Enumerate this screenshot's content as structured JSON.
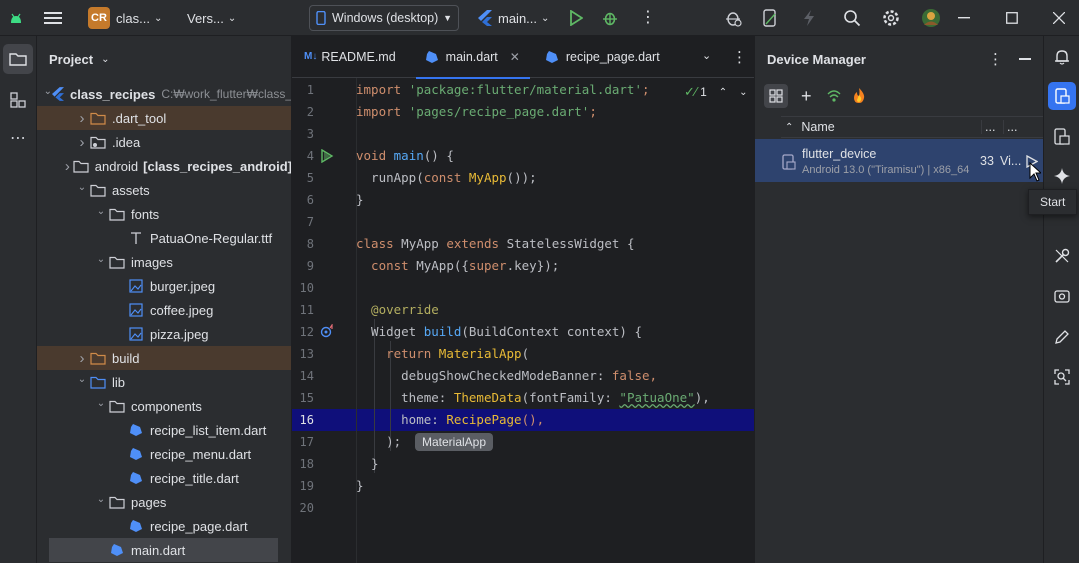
{
  "titlebar": {
    "project_badge": "CR",
    "project_name": "clas...",
    "vcs_label": "Vers...",
    "device_selector": "Windows (desktop)",
    "run_config": "main..."
  },
  "project_panel": {
    "title": "Project",
    "root_name": "class_recipes",
    "root_path": "C:₩work_flutter₩class_",
    "tree": [
      {
        "label": "class_recipes",
        "depth": 0
      },
      {
        "label": ".dart_tool",
        "depth": 1
      },
      {
        "label": ".idea",
        "depth": 1
      },
      {
        "label": "android",
        "extra": "[class_recipes_android]",
        "depth": 1
      },
      {
        "label": "assets",
        "depth": 1
      },
      {
        "label": "fonts",
        "depth": 2
      },
      {
        "label": "PatuaOne-Regular.ttf",
        "depth": 3
      },
      {
        "label": "images",
        "depth": 2
      },
      {
        "label": "burger.jpeg",
        "depth": 3
      },
      {
        "label": "coffee.jpeg",
        "depth": 3
      },
      {
        "label": "pizza.jpeg",
        "depth": 3
      },
      {
        "label": "build",
        "depth": 1
      },
      {
        "label": "lib",
        "depth": 1
      },
      {
        "label": "components",
        "depth": 2
      },
      {
        "label": "recipe_list_item.dart",
        "depth": 3
      },
      {
        "label": "recipe_menu.dart",
        "depth": 3
      },
      {
        "label": "recipe_title.dart",
        "depth": 3
      },
      {
        "label": "pages",
        "depth": 2
      },
      {
        "label": "recipe_page.dart",
        "depth": 3
      },
      {
        "label": "main.dart",
        "depth": 2
      }
    ]
  },
  "editor": {
    "tabs": [
      {
        "label": "README.md",
        "prefix": "M↓"
      },
      {
        "label": "main.dart"
      },
      {
        "label": "recipe_page.dart"
      }
    ],
    "inspection_count": "1",
    "line_numbers": [
      "1",
      "2",
      "3",
      "4",
      "5",
      "6",
      "7",
      "8",
      "9",
      "10",
      "11",
      "12",
      "13",
      "14",
      "15",
      "16",
      "17",
      "18",
      "19",
      "20"
    ],
    "hint": "MaterialApp",
    "current_line": "16",
    "code": {
      "l1_kw": "import",
      "l1_str": "'package:flutter/material.dart'",
      "l1_end": ";",
      "l2_kw": "import",
      "l2_str": "'pages/recipe_page.dart'",
      "l2_end": ";",
      "l4_kw": "void",
      "l4_fn": "main",
      "l4_rest": "() {",
      "l5_a": "  runApp(",
      "l5_kw": "const",
      "l5_cls": "MyApp",
      "l5_rest": "());",
      "l6": "}",
      "l8_kw": "class",
      "l8_cls": "MyApp",
      "l8_kw2": "extends",
      "l8_cls2": "StatelessWidget",
      "l8_rest": " {",
      "l9_kw": "  const",
      "l9_cls": "MyApp",
      "l9_a": "({",
      "l9_kw2": "super",
      "l9_b": ".key});",
      "l11_ann": "  @override",
      "l12_a": "  Widget ",
      "l12_fn": "build",
      "l12_b": "(BuildContext context) {",
      "l13_kw": "    return",
      "l13_cls": "MaterialApp",
      "l13_b": "(",
      "l14_a": "      debugShowCheckedModeBanner: ",
      "l14_kw": "false",
      "l14_b": ",",
      "l15_a": "      theme: ",
      "l15_cls": "ThemeData",
      "l15_b": "(fontFamily: ",
      "l15_str": "\"PatuaOne\"",
      "l15_c": "),",
      "l16_a": "      home: ",
      "l16_cls": "RecipePage",
      "l16_b": "(),",
      "l17_a": "    );",
      "l18_a": "  }",
      "l19_a": "}"
    }
  },
  "device_manager": {
    "title": "Device Manager",
    "column_name": "Name",
    "col_more1": "...",
    "col_more2": "...",
    "device": {
      "name": "flutter_device",
      "details": "Android 13.0 (\"Tiramisu\") | x86_64",
      "api": "33",
      "type": "Vi..."
    },
    "tooltip": "Start"
  },
  "colors": {
    "accent": "#3574f0",
    "selection": "#2e436e",
    "current_line": "#0f0f7a"
  }
}
